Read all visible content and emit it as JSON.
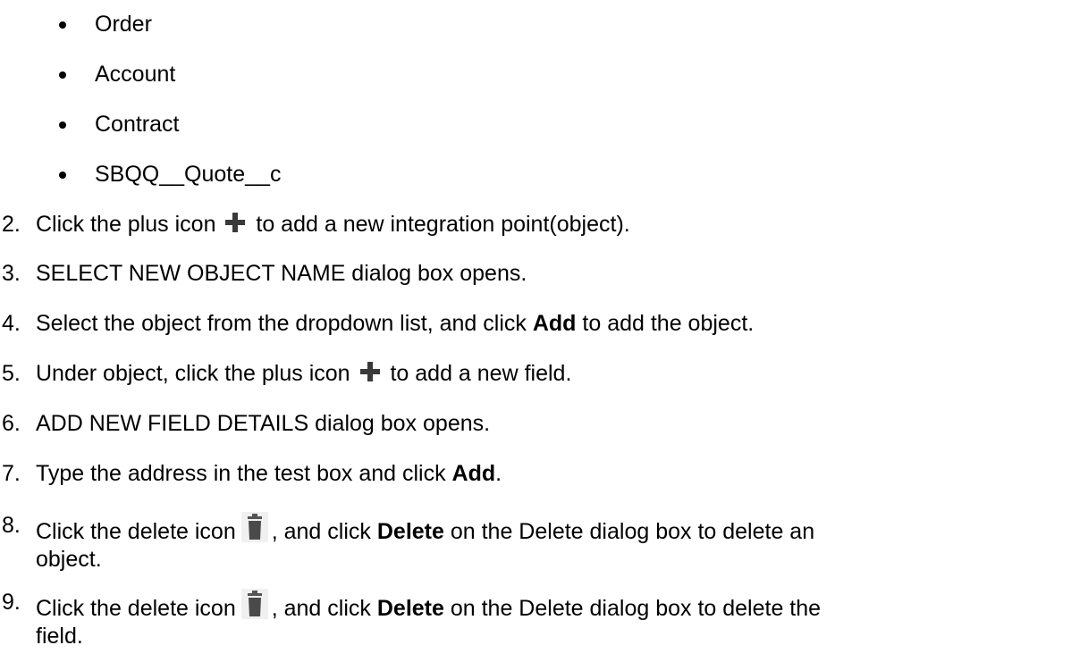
{
  "bullets": [
    "Order",
    "Account",
    "Contract",
    "SBQQ__Quote__c"
  ],
  "steps": [
    {
      "num": "2.",
      "before": "Click the plus icon",
      "icon": "plus-icon",
      "after": "to add a new integration point(object)."
    },
    {
      "num": "3.",
      "text": "SELECT NEW OBJECT NAME dialog box opens."
    },
    {
      "num": "4.",
      "before": "Select the object from the dropdown list, and click",
      "bold": "Add",
      "after": "to add the object."
    },
    {
      "num": "5.",
      "before": "Under object, click the plus icon",
      "icon": "plus-icon",
      "after": "to add a new field."
    },
    {
      "num": "6.",
      "text": "ADD NEW FIELD DETAILS dialog box opens."
    },
    {
      "num": "7.",
      "before": "Type the address in the test box and click",
      "bold": "Add",
      "after": "."
    },
    {
      "num": "8.",
      "before": "Click the delete icon",
      "icon": "trash-icon",
      "after1": ", and click",
      "bold": "Delete",
      "after": "on the Delete dialog box to delete an",
      "line2": "object."
    },
    {
      "num": "9.",
      "before": "Click the delete icon",
      "icon": "trash-icon",
      "after1": ", and click",
      "bold": "Delete",
      "after": "on the Delete dialog box to delete the",
      "line2": "field."
    }
  ]
}
